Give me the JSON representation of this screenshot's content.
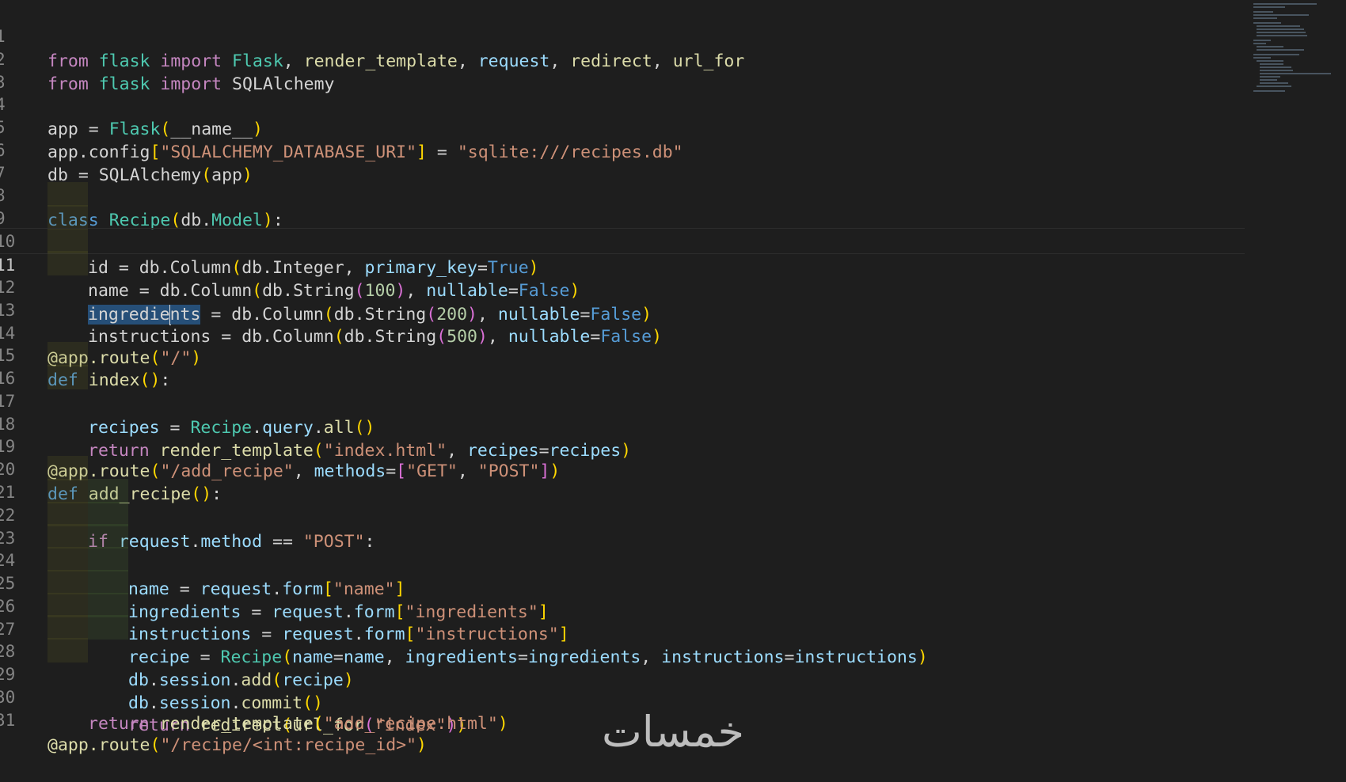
{
  "editor": {
    "lines": [
      {
        "n": "1"
      },
      {
        "n": "2"
      },
      {
        "n": "3"
      },
      {
        "n": "4"
      },
      {
        "n": "5"
      },
      {
        "n": "6"
      },
      {
        "n": "7"
      },
      {
        "n": "8"
      },
      {
        "n": "9"
      },
      {
        "n": "10"
      },
      {
        "n": "11"
      },
      {
        "n": "12"
      },
      {
        "n": "13"
      },
      {
        "n": "14"
      },
      {
        "n": "15"
      },
      {
        "n": "16"
      },
      {
        "n": "17"
      },
      {
        "n": "18"
      },
      {
        "n": "19"
      },
      {
        "n": "20"
      },
      {
        "n": "21"
      },
      {
        "n": "22"
      },
      {
        "n": "23"
      },
      {
        "n": "24"
      },
      {
        "n": "25"
      },
      {
        "n": "26"
      },
      {
        "n": "27"
      },
      {
        "n": "28"
      },
      {
        "n": "29"
      },
      {
        "n": "30"
      },
      {
        "n": "31"
      }
    ],
    "tokens": {
      "t_from": "from",
      "t_flask_mod": "flask",
      "t_import": "import",
      "t_Flask": "Flask",
      "t_render_template": "render_template",
      "t_request": "request",
      "t_redirect": "redirect",
      "t_url_for": "url_for",
      "t_SQLAlchemy": "SQLAlchemy",
      "t_app": "app",
      "t_name_dunder": "__name__",
      "t_config": "config",
      "t_uri_key": "\"SQLALCHEMY_DATABASE_URI\"",
      "t_uri_val": "\"sqlite:///recipes.db\"",
      "t_db": "db",
      "t_class": "class",
      "t_Recipe": "Recipe",
      "t_Model": "Model",
      "t_id": "id",
      "t_Column": "Column",
      "t_Integer": "Integer",
      "t_primary_key": "primary_key",
      "t_True": "True",
      "t_name": "name",
      "t_String": "String",
      "t_100": "100",
      "t_nullable": "nullable",
      "t_False": "False",
      "t_ingredie": "ingredie",
      "t_nts": "nts",
      "t_200": "200",
      "t_instructions": "instructions",
      "t_500": "500",
      "t_route": "route",
      "t_s_root": "\"/\"",
      "t_def": "def",
      "t_index": "index",
      "t_recipes": "recipes",
      "t_query": "query",
      "t_all": "all",
      "t_return": "return",
      "t_s_index_html": "\"index.html\"",
      "t_s_add_recipe": "\"/add_recipe\"",
      "t_methods": "methods",
      "t_s_GET": "\"GET\"",
      "t_s_POST": "\"POST\"",
      "t_add_recipe": "add_recipe",
      "t_if": "if",
      "t_method": "method",
      "t_form": "form",
      "t_s_name": "\"name\"",
      "t_ingredients": "ingredients",
      "t_s_ingredients": "\"ingredients\"",
      "t_s_instructions": "\"instructions\"",
      "t_recipe": "recipe",
      "t_session": "session",
      "t_add": "add",
      "t_commit": "commit",
      "t_s_index": "\"index\"",
      "t_s_add_recipe_html": "\"add_recipe.html\"",
      "t_s_recipe_route": "\"/recipe/<int:recipe_id>\""
    }
  },
  "watermark": {
    "text": "خمسات"
  },
  "theme": {
    "background": "#1e1e1e",
    "selection": "#264f78"
  }
}
